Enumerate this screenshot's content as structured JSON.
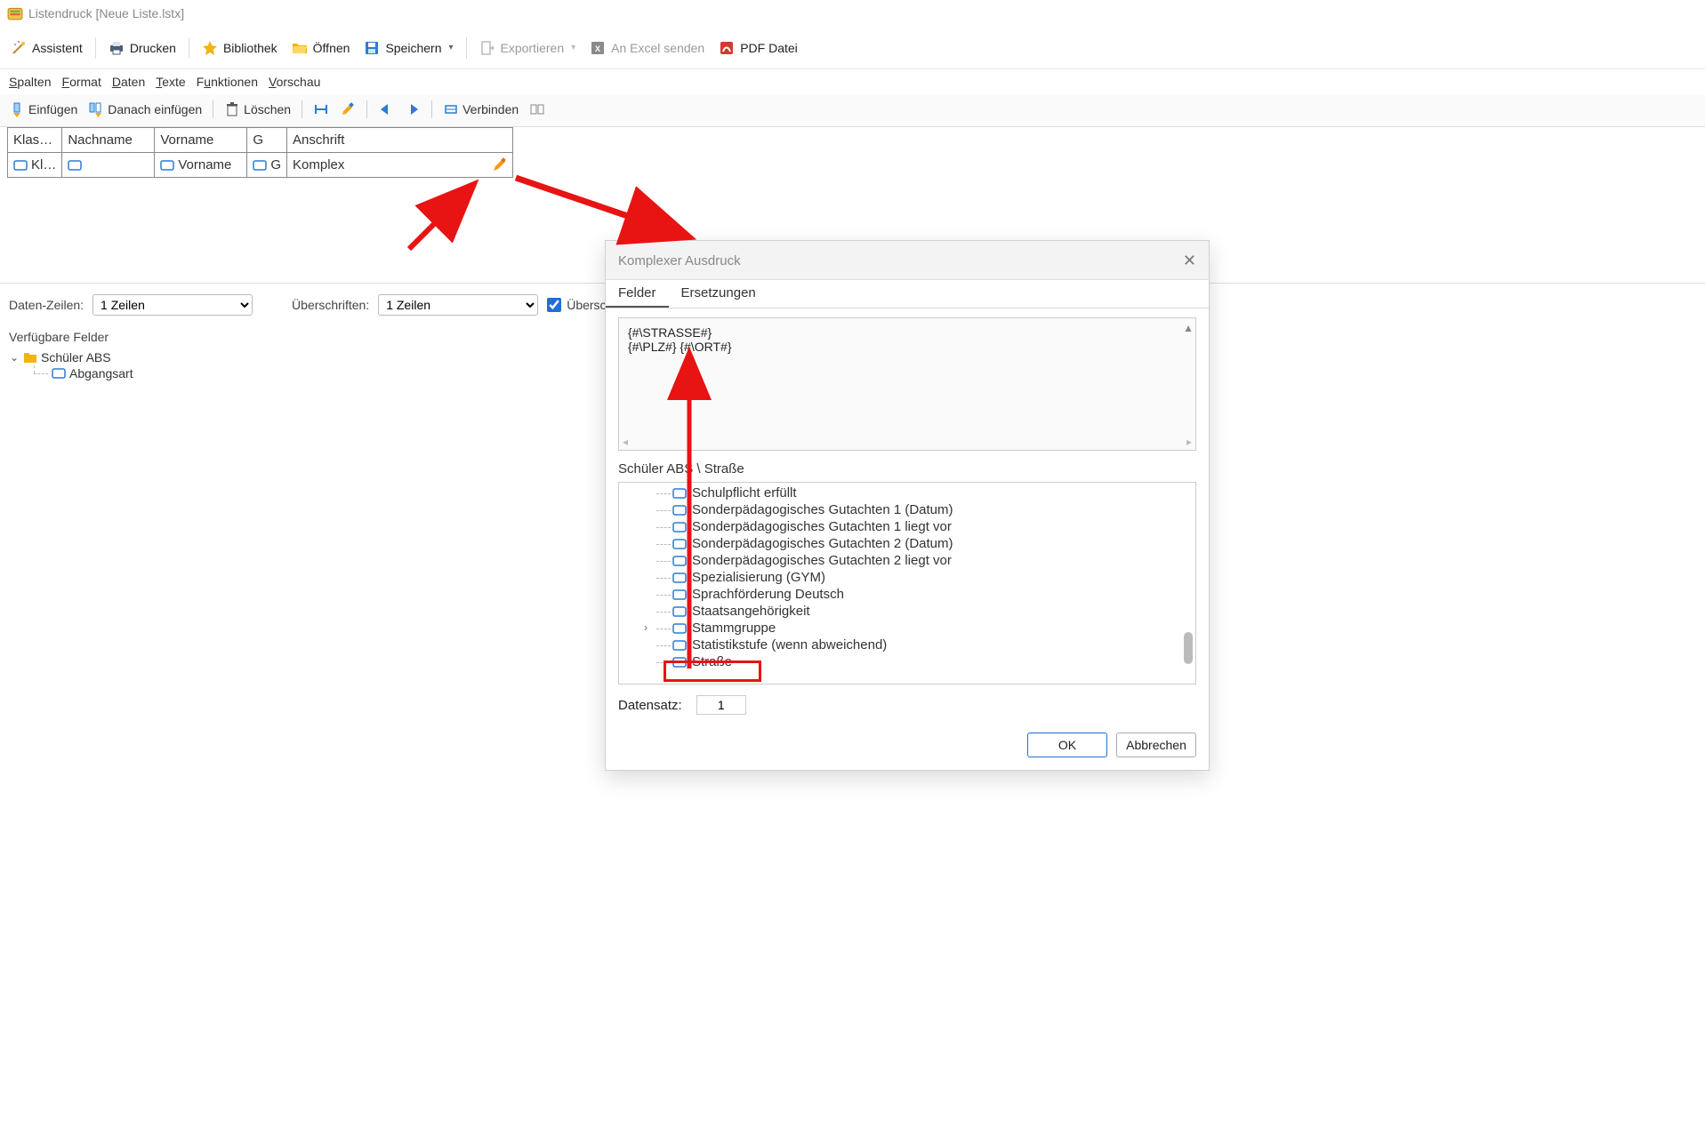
{
  "window": {
    "title": "Listendruck [Neue Liste.lstx]"
  },
  "toolbar": {
    "assistent": "Assistent",
    "drucken": "Drucken",
    "bibliothek": "Bibliothek",
    "oeffnen": "Öffnen",
    "speichern": "Speichern",
    "exportieren": "Exportieren",
    "excel": "An Excel senden",
    "pdf": "PDF Datei"
  },
  "menu": {
    "spalten": "Spalten",
    "format": "Format",
    "daten": "Daten",
    "texte": "Texte",
    "funktionen": "Funktionen",
    "vorschau": "Vorschau"
  },
  "subtoolbar": {
    "einfuegen": "Einfügen",
    "danach": "Danach einfügen",
    "loeschen": "Löschen",
    "verbinden": "Verbinden"
  },
  "grid": {
    "headers": [
      "Klas…",
      "Nachname",
      "Vorname",
      "G",
      "Anschrift"
    ],
    "row": {
      "c1": "Kl…",
      "c2": "",
      "c3": "Vorname",
      "c4": "G",
      "c5": "Komplex"
    }
  },
  "mid": {
    "datenzeilen_label": "Daten-Zeilen:",
    "datenzeilen_value": "1 Zeilen",
    "ueberschriften_label": "Überschriften:",
    "ueberschriften_value": "1 Zeilen",
    "ueberschrifte_chk": "Überschrifte"
  },
  "available": {
    "title": "Verfügbare Felder",
    "root": "Schüler ABS",
    "child": "Abgangsart"
  },
  "dialog": {
    "title": "Komplexer Ausdruck",
    "tab_felder": "Felder",
    "tab_ersetzungen": "Ersetzungen",
    "expression": "{#\\STRASSE#}\n{#\\PLZ#} {#\\ORT#}",
    "breadcrumb": "Schüler ABS \\ Straße",
    "fields": [
      "Schulpflicht erfüllt",
      "Sonderpädagogisches Gutachten 1 (Datum)",
      "Sonderpädagogisches Gutachten 1 liegt vor",
      "Sonderpädagogisches Gutachten 2 (Datum)",
      "Sonderpädagogisches Gutachten 2 liegt vor",
      "Spezialisierung (GYM)",
      "Sprachförderung Deutsch",
      "Staatsangehörigkeit",
      "Stammgruppe",
      "Statistikstufe (wenn abweichend)",
      "Straße"
    ],
    "datensatz_label": "Datensatz:",
    "datensatz_value": "1",
    "ok": "OK",
    "cancel": "Abbrechen"
  }
}
